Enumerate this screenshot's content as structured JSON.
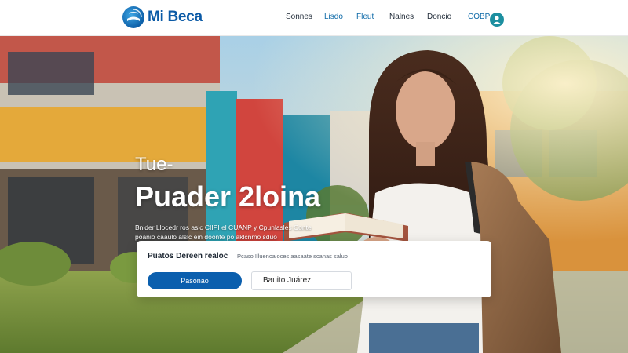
{
  "brand": {
    "name": "Mi Beca",
    "logo_icon": "book-globe-icon"
  },
  "nav": {
    "items": [
      {
        "label": "Sonnes"
      },
      {
        "label": "Lisdo"
      },
      {
        "label": "Fleut"
      },
      {
        "label": "Nalnes"
      },
      {
        "label": "Doncio"
      },
      {
        "label": "COBP"
      }
    ],
    "badge_icon": "user-icon"
  },
  "hero": {
    "line1": "Tue-",
    "line2": "Puader 2loina",
    "subtitle": "Bnider Llocedr ros aslc CIIPI el CUANP y Cpunlasles Conte poanio caaulo alslc ein doonte po aklcnmo sduo"
  },
  "search": {
    "title": "Puatos Dereen realoc",
    "hint": "Pcaso Illuencaloces aasaate scanas saluo",
    "button_label": "Pasonao",
    "input_value": "Bauito Juárez"
  },
  "colors": {
    "brand": "#0b5aa6",
    "button": "#0b5fae",
    "badge": "#1c8fa0"
  }
}
